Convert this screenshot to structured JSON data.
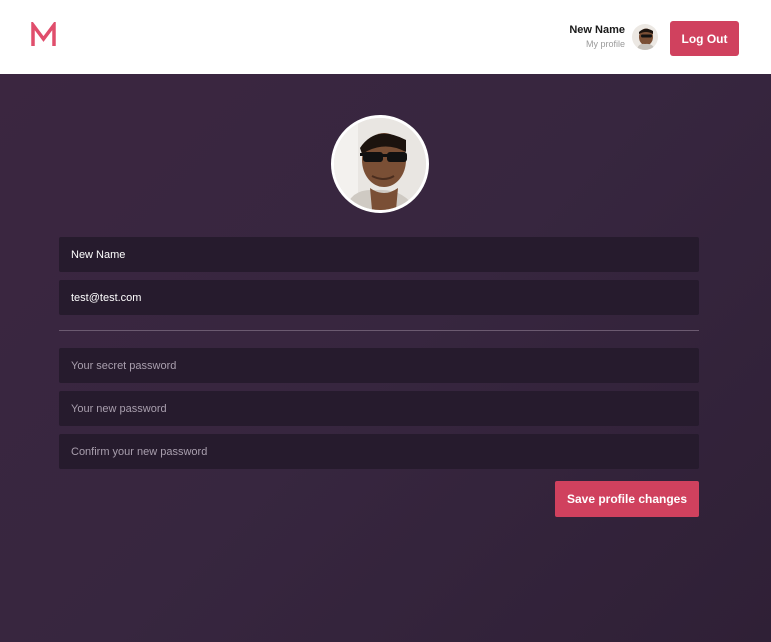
{
  "header": {
    "logo_icon": "m-letter-logo-icon",
    "user_name": "New Name",
    "user_link": "My profile",
    "avatar_icon": "user-avatar-icon",
    "logout_label": "Log Out"
  },
  "profile": {
    "avatar_icon": "profile-photo-icon",
    "name_value": "New Name",
    "email_value": "test@test.com",
    "password_placeholder": "Your secret password",
    "new_password_placeholder": "Your new password",
    "confirm_password_placeholder": "Confirm your new password",
    "save_label": "Save profile changes"
  },
  "colors": {
    "accent": "#d0415e",
    "background": "#37263f",
    "field_background": "#261b2d",
    "header_background": "#ffffff"
  }
}
